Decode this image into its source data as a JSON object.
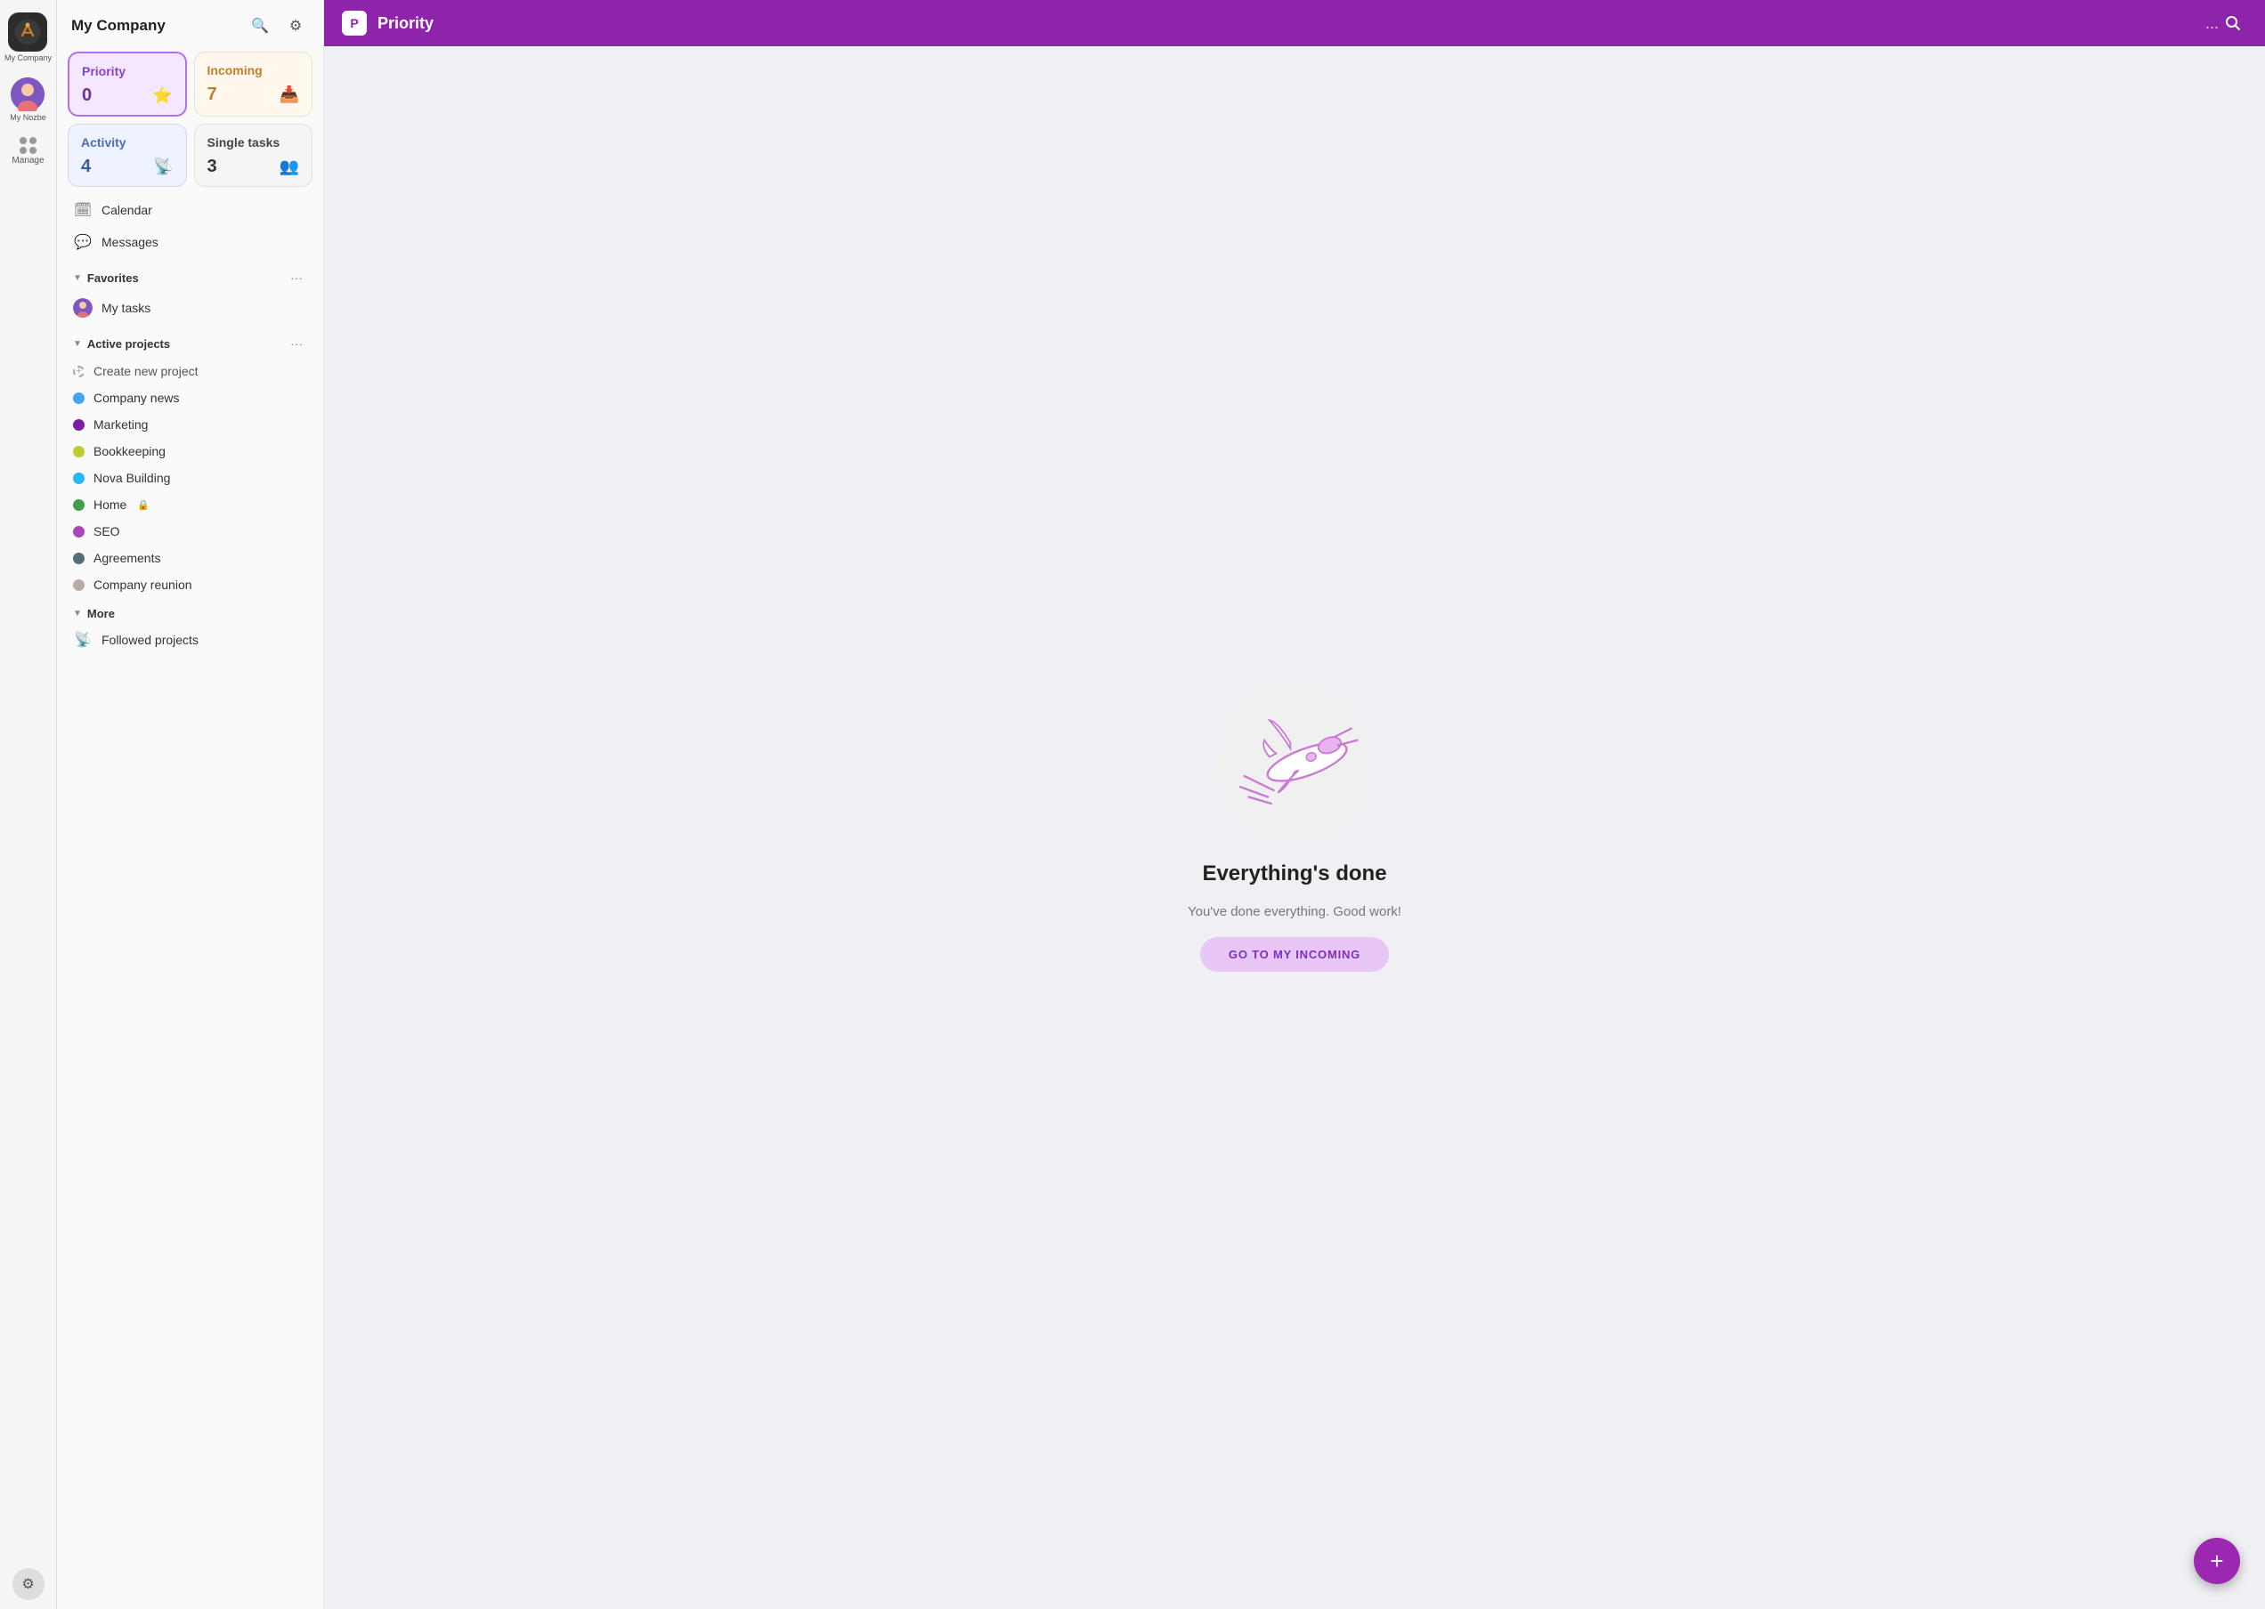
{
  "app": {
    "name": "My Company",
    "logo_initials": "N"
  },
  "icon_bar": {
    "logo_tooltip": "My Company",
    "logo_label": "My Company",
    "avatar_label": "My Nozbe",
    "manage_label": "Manage"
  },
  "sidebar": {
    "title": "My Company",
    "search_label": "Search",
    "settings_label": "Settings"
  },
  "quick_cards": [
    {
      "id": "priority",
      "label": "Priority",
      "count": "0",
      "icon": "⭐",
      "style": "priority"
    },
    {
      "id": "incoming",
      "label": "Incoming",
      "count": "7",
      "icon": "📥",
      "style": "incoming"
    },
    {
      "id": "activity",
      "label": "Activity",
      "count": "4",
      "icon": "📡",
      "style": "activity"
    },
    {
      "id": "single-tasks",
      "label": "Single tasks",
      "count": "3",
      "icon": "👥",
      "style": "single"
    }
  ],
  "nav_items": [
    {
      "id": "calendar",
      "label": "Calendar",
      "icon": "🗓"
    },
    {
      "id": "messages",
      "label": "Messages",
      "icon": "💬"
    }
  ],
  "favorites": {
    "label": "Favorites",
    "more_label": "...",
    "items": [
      {
        "id": "my-tasks",
        "label": "My tasks",
        "color": "#e57373",
        "has_avatar": true
      }
    ]
  },
  "active_projects": {
    "label": "Active projects",
    "more_label": "...",
    "create_label": "Create new project",
    "items": [
      {
        "id": "company-news",
        "label": "Company news",
        "color": "#42a5f5"
      },
      {
        "id": "marketing",
        "label": "Marketing",
        "color": "#7b1fa2"
      },
      {
        "id": "bookkeeping",
        "label": "Bookkeeping",
        "color": "#c0ca33"
      },
      {
        "id": "nova-building",
        "label": "Nova Building",
        "color": "#29b6f6"
      },
      {
        "id": "home",
        "label": "Home",
        "color": "#43a047",
        "locked": true
      },
      {
        "id": "seo",
        "label": "SEO",
        "color": "#ab47bc"
      },
      {
        "id": "agreements",
        "label": "Agreements",
        "color": "#546e7a"
      },
      {
        "id": "company-reunion",
        "label": "Company reunion",
        "color": "#bcaaa4"
      }
    ]
  },
  "more_section": {
    "label": "More",
    "items": [
      {
        "id": "followed-projects",
        "label": "Followed projects",
        "icon": "📡"
      }
    ]
  },
  "main_header": {
    "logo_text": "P",
    "title": "Priority",
    "dots_label": "...",
    "search_label": "Search"
  },
  "main_content": {
    "empty_title": "Everything's done",
    "empty_subtitle": "You've done everything. Good work!",
    "goto_btn_label": "GO TO MY INCOMING"
  },
  "fab": {
    "label": "+"
  }
}
